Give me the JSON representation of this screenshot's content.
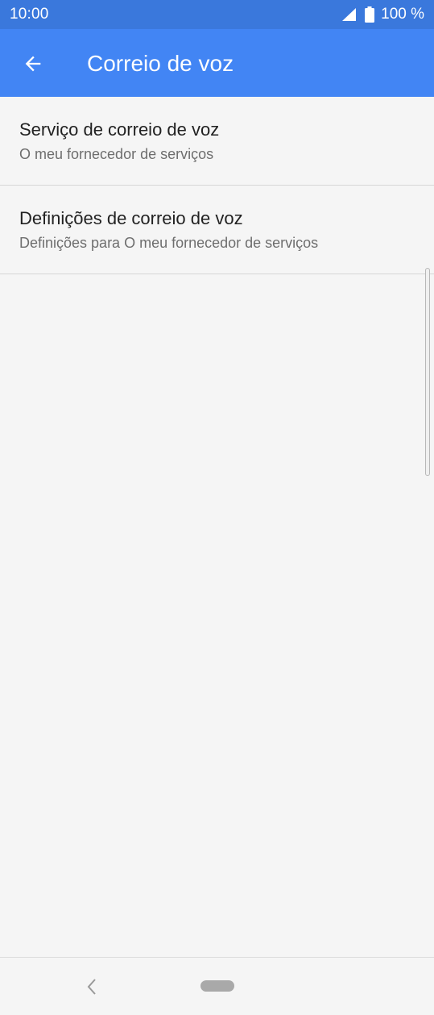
{
  "status_bar": {
    "time": "10:00",
    "battery_text": "100 %",
    "icons": [
      "signal-icon",
      "battery-icon"
    ]
  },
  "app_bar": {
    "title": "Correio de voz",
    "back_icon": "arrow-back-icon"
  },
  "list": {
    "items": [
      {
        "title": "Serviço de correio de voz",
        "subtitle": "O meu fornecedor de serviços"
      },
      {
        "title": "Definições de correio de voz",
        "subtitle": "Definições para O meu fornecedor de serviços"
      }
    ]
  },
  "nav_bar": {
    "icons": [
      "nav-back-icon",
      "home-pill"
    ]
  },
  "colors": {
    "status_bar": "#3a78dc",
    "app_bar": "#4285f4",
    "background": "#f5f5f5",
    "title_text": "#222222",
    "subtitle_text": "#6e6e6e"
  }
}
